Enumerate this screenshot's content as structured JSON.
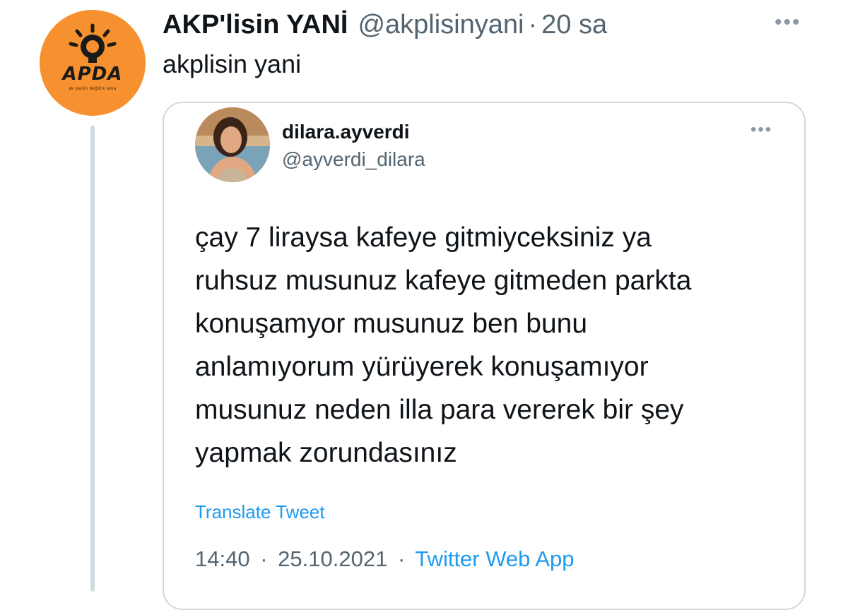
{
  "tweet": {
    "author_name": "AKP'lisin YANİ",
    "author_handle": "@akplisinyani",
    "separator": "·",
    "time": "20 sa",
    "text": "akplisin yani",
    "more_icon": "more-horizontal-icon",
    "avatar": {
      "logo_text": "APDA",
      "logo_subtext": "ak partili değilim ama",
      "bg_color": "#f7902f"
    }
  },
  "quoted": {
    "name": "dilara.ayverdi",
    "handle": "@ayverdi_dilara",
    "lines": [
      "çay 7 liraysa kafeye gitmiyceksiniz ya",
      "ruhsuz musunuz kafeye gitmeden parkta",
      "konuşamyor musunuz ben bunu",
      "anlamıyorum yürüyerek konuşamıyor",
      "musunuz neden illa para vererek bir şey",
      "yapmak zorundasınız"
    ],
    "translate_label": "Translate Tweet",
    "time": "14:40",
    "date": "25.10.2021",
    "separator": "·",
    "source": "Twitter Web App"
  },
  "colors": {
    "link": "#1d9bf0",
    "secondary_text": "#536471",
    "border": "#cfd9de",
    "thread_line": "#cfd9de"
  }
}
